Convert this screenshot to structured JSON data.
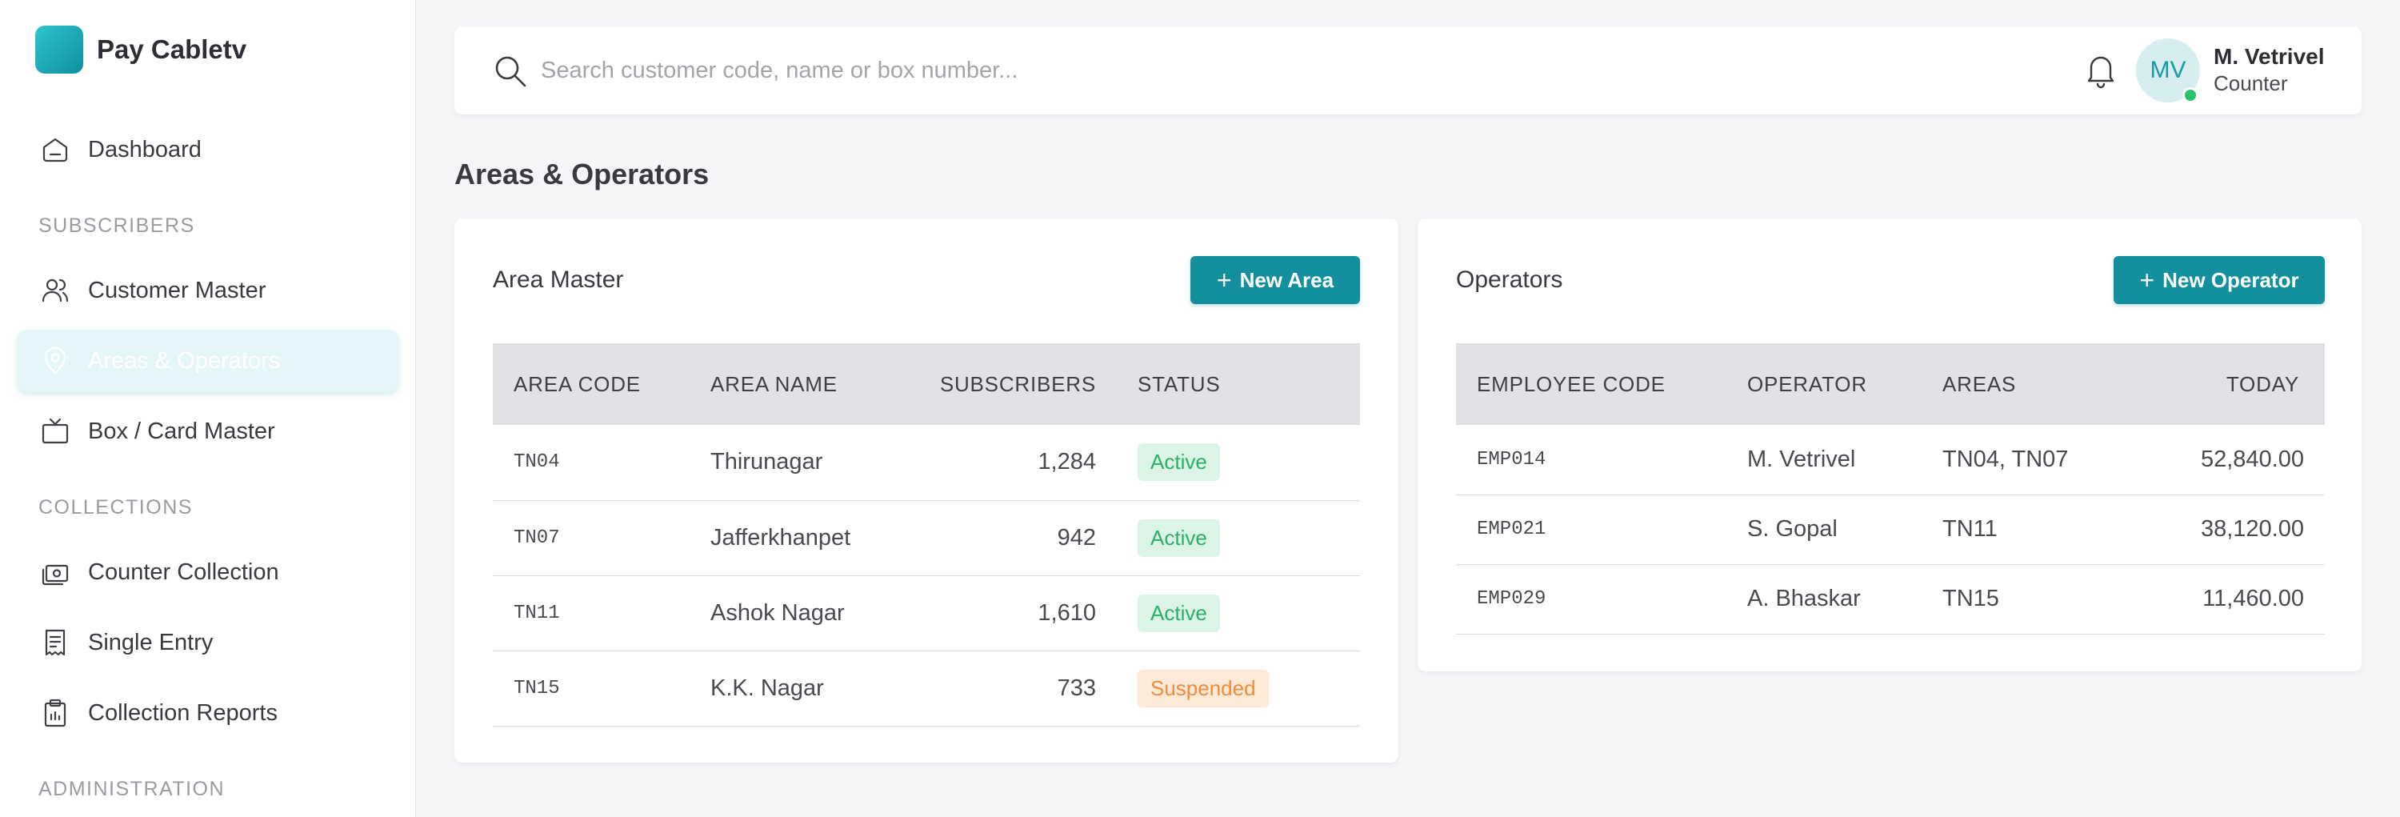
{
  "brand": {
    "name": "Pay Cabletv"
  },
  "sidebar": {
    "dashboard": "Dashboard",
    "sections": {
      "subscribers": "SUBSCRIBERS",
      "collections": "COLLECTIONS",
      "administration": "ADMINISTRATION"
    },
    "items": {
      "customer_master": "Customer Master",
      "areas_operators": "Areas & Operators",
      "box_card_master": "Box / Card Master",
      "counter_collection": "Counter Collection",
      "single_entry": "Single Entry",
      "collection_reports": "Collection Reports"
    },
    "active_item": "areas_operators"
  },
  "topbar": {
    "search_placeholder": "Search customer code, name or box number...",
    "search_value": "",
    "user": {
      "initials": "MV",
      "name": "M. Vetrivel",
      "role": "Counter",
      "online": true
    }
  },
  "page": {
    "title": "Areas & Operators"
  },
  "area_master": {
    "title": "Area Master",
    "button": "New Area",
    "columns": [
      "AREA CODE",
      "AREA NAME",
      "SUBSCRIBERS",
      "STATUS"
    ],
    "rows": [
      {
        "code": "TN04",
        "name": "Thirunagar",
        "subscribers": "1,284",
        "status": "Active"
      },
      {
        "code": "TN07",
        "name": "Jafferkhanpet",
        "subscribers": "942",
        "status": "Active"
      },
      {
        "code": "TN11",
        "name": "Ashok Nagar",
        "subscribers": "1,610",
        "status": "Active"
      },
      {
        "code": "TN15",
        "name": "K.K. Nagar",
        "subscribers": "733",
        "status": "Suspended"
      }
    ]
  },
  "operators": {
    "title": "Operators",
    "button": "New Operator",
    "columns": [
      "EMPLOYEE CODE",
      "OPERATOR",
      "AREAS",
      "TODAY"
    ],
    "rows": [
      {
        "code": "EMP014",
        "name": "M. Vetrivel",
        "areas": "TN04, TN07",
        "today": "52,840.00"
      },
      {
        "code": "EMP021",
        "name": "S. Gopal",
        "areas": "TN11",
        "today": "38,120.00"
      },
      {
        "code": "EMP029",
        "name": "A. Bhaskar",
        "areas": "TN15",
        "today": "11,460.00"
      }
    ]
  },
  "colors": {
    "accent": "#138f9d",
    "active_badge": "#2bb068",
    "suspended_badge": "#ee8d3a",
    "online_dot": "#29c26c"
  }
}
